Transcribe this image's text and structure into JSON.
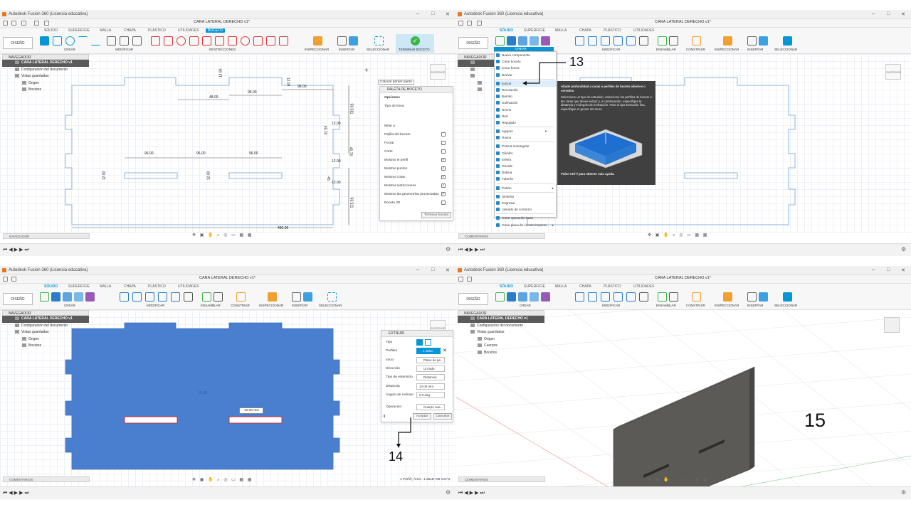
{
  "app_title": "Autodesk Fusion 360 (Licencia educativa)",
  "doc_tab": "CARA LATERAL DERECHO v1*",
  "design_button": "DISEÑO",
  "tabs": [
    "SÓLIDO",
    "SUPERFICIE",
    "MALLA",
    "CHAPA",
    "PLÁSTICO",
    "UTILIDADES",
    "BOCETO"
  ],
  "q1": {
    "groups": [
      "CREAR",
      "MODIFICAR",
      "RESTRICCIONES",
      "INSPECCIONAR",
      "INSERTAR",
      "SELECCIONAR",
      "TERMINAR BOCETO"
    ],
    "navigator": {
      "header": "NAVEGADOR",
      "items": [
        "CARA LATERAL DERECHO v1",
        "Configuración del documento",
        "Vistas guardadas",
        "Origen",
        "Bocetos"
      ]
    },
    "comments": "COMENTARIOS",
    "cursor_hint": "Colocar primer punto",
    "palette": {
      "title": "PALETA DE BOCETO",
      "section": "Opciones",
      "rows": [
        "Tipo de línea",
        "",
        "Mirar a",
        "Rejilla del boceto",
        "Forzar",
        "Corte",
        "Mostrar el perfil",
        "Mostrar puntos",
        "Mostrar cotas",
        "Mostrar restricciones",
        "Mostrar las geometrías proyectadas",
        "Boceto 3D"
      ],
      "finish": "Terminar boceto"
    },
    "dims": {
      "d4800": "48.00",
      "d9600": "96.00",
      "d12": "12.00",
      "d5951": "59.511",
      "d4570": "45.70",
      "d480": "480.00",
      "d45": "45",
      "d1200": "12.00"
    }
  },
  "q2": {
    "groups": [
      "CREAR",
      "MODIFICAR",
      "ENSAMBLAR",
      "CONSTRUIR",
      "INSPECCIONAR",
      "INSERTAR",
      "SELECCIONAR"
    ],
    "menu_items": [
      "Nuevo componente",
      "Crear boceto",
      "Crear forma",
      "Derivar",
      "Extruir",
      "Revolución",
      "Barrido",
      "Solevación",
      "Nervio",
      "Red",
      "Repujado",
      "Agujero",
      "Rosca",
      "Prisma rectangular",
      "Cilindro",
      "Esfera",
      "Toroide",
      "Bobina",
      "Tubería",
      "Patrón",
      "Simetría",
      "Engrosar",
      "Llenado de contorno",
      "Crear operación base",
      "Crear placa de circuito impreso"
    ],
    "hole_shortcut": "H",
    "tooltip_title": "Añade profundidad a caras o perfiles de boceto abiertos o cerrados.",
    "tooltip_body": "Seleccione un tipo de extrusión, seleccione los perfiles de boceto o las caras que desee extruir y, a continuación, especifique la distancia y el ángulo de inclinación. Para el tipo Extrusión fina, especifique el grosor del muro.",
    "tooltip_help": "Pulse Ctrl+/ para obtener más ayuda.",
    "step": "13",
    "comments": "COMENTARIOS"
  },
  "q3": {
    "extrude": {
      "title": "EXTRUIR",
      "rows": [
        "Tipo",
        "Perfiles",
        "Inicio",
        "Dirección",
        "Tipo de extensión",
        "Distancia",
        "Ángulo de inclinac.",
        "Operación"
      ],
      "perfiles_value": "1 selec.",
      "inicio_value": "Plano de pe...",
      "direccion_value": "Un lado",
      "extension_value": "Distancia",
      "distancia_value": "12.00 mm",
      "angulo_value": "0.0 deg",
      "operacion_value": "Cuerpo nue...",
      "accept": "Aceptar",
      "cancel": "Cancelar"
    },
    "inline_value": "12.00 mm",
    "faint_value": "12.00",
    "status": "1 Perfil | Área : 1.251E+05 mm^2",
    "step": "14",
    "comments": "COMENTARIOS"
  },
  "q4": {
    "step": "15",
    "comments": "COMENTARIOS"
  },
  "colors": {
    "accent": "#0696d7",
    "sketch_line": "#8fb4d8",
    "profile_fill": "#4a7fd0",
    "solid": "#5c5a57"
  }
}
